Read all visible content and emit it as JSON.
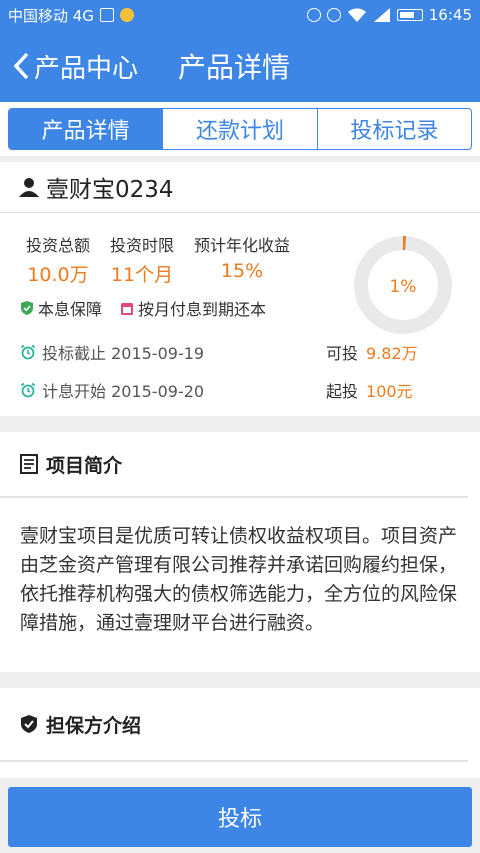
{
  "status_bar": {
    "carrier": "中国移动 4G",
    "time": "16:45"
  },
  "nav": {
    "back_label": "产品中心",
    "title": "产品详情"
  },
  "tabs": [
    {
      "label": "产品详情"
    },
    {
      "label": "还款计划"
    },
    {
      "label": "投标记录"
    }
  ],
  "product": {
    "name": "壹财宝0234",
    "stats": [
      {
        "label": "投资总额",
        "value": "10.0万"
      },
      {
        "label": "投资时限",
        "value": "11个月"
      },
      {
        "label": "预计年化收益",
        "value": "15%"
      }
    ],
    "progress_label": "1%",
    "progress_value": 0.01,
    "tags": [
      {
        "label": "本息保障"
      },
      {
        "label": "按月付息到期还本"
      }
    ],
    "deadline": "投标截止 2015-09-19",
    "interest_start": "计息开始 2015-09-20",
    "available_label": "可投",
    "available_value": "9.82万",
    "min_label": "起投",
    "min_value": "100元"
  },
  "intro": {
    "title": "项目简介",
    "text": "壹财宝项目是优质可转让债权收益权项目。项目资产由芝金资产管理有限公司推荐并承诺回购履约担保，依托推荐机构强大的债权筛选能力，全方位的风险保障措施，通过壹理财平台进行融资。"
  },
  "guarantor": {
    "title": "担保方介绍"
  },
  "invest_button": "投标",
  "colors": {
    "primary": "#3d86e6",
    "accent": "#f07a1c",
    "shield_green": "#3aa856",
    "calendar_pink": "#e0477a",
    "clock_teal": "#2bb59a"
  }
}
